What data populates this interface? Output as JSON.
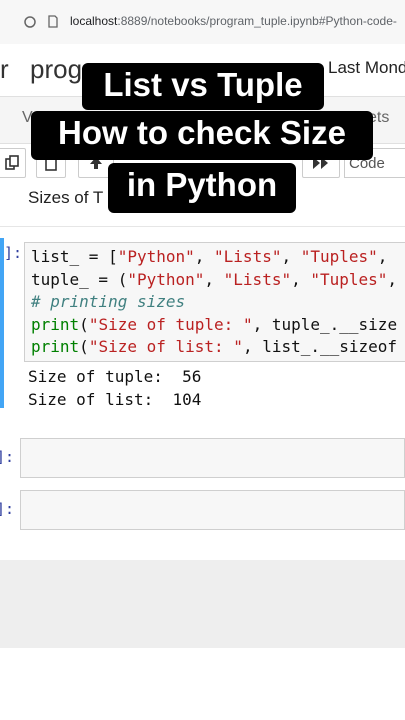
{
  "browser": {
    "url_host": "localhost",
    "url_rest": ":8889/notebooks/program_tuple.ipynb#Python-code-"
  },
  "notebook": {
    "logo_fragment": "r",
    "name_fragment": "prog",
    "checkpoint_fragment": "Last Mond"
  },
  "menubar": {
    "left_fragment": "V",
    "right_fragment": "ets"
  },
  "toolbar": {
    "cell_type_fragment": "Code"
  },
  "cells": {
    "markdown_fragment": "Sizes of T",
    "code_prompt": "]:",
    "code_lines": [
      "list_ = [\"Python\", \"Lists\", \"Tuples\",",
      "tuple_ = (\"Python\", \"Lists\", \"Tuples\",",
      "# printing sizes",
      "print(\"Size of tuple: \", tuple_.__size",
      "print(\"Size of list: \", list_.__sizeof"
    ],
    "output_lines": [
      "Size of tuple:  56",
      "Size of list:  104"
    ],
    "empty_prompt_1": "]:",
    "empty_prompt_2": "]:"
  },
  "overlay": {
    "line1": "List vs Tuple",
    "line2": "How to check Size",
    "line3": "in Python"
  }
}
